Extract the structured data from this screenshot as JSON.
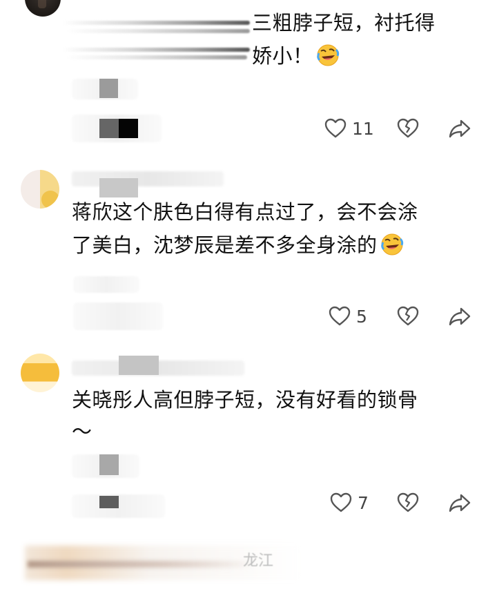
{
  "comments": [
    {
      "text_lines": [
        "三粗脖子短，衬托得",
        "娇小！"
      ],
      "emoji": "rolling-laughing-emoji",
      "likes": "11"
    },
    {
      "text_lines": [
        "蒋欣这个肤色白得有点过了，会不会涂",
        "了美白，沈梦辰是差不多全身涂的"
      ],
      "emoji": "rolling-laughing-emoji",
      "likes": "5"
    },
    {
      "text_lines": [
        "关晓彤人高但脖子短，没有好看的锁骨",
        "～"
      ],
      "likes": "7"
    }
  ],
  "bottom_partial_text": "龙江",
  "icons": {
    "like": "heart-outline-icon",
    "dislike": "broken-heart-icon",
    "share": "share-arrow-icon"
  },
  "colors": {
    "text": "#111111",
    "icon": "#555555",
    "count": "#444444"
  }
}
